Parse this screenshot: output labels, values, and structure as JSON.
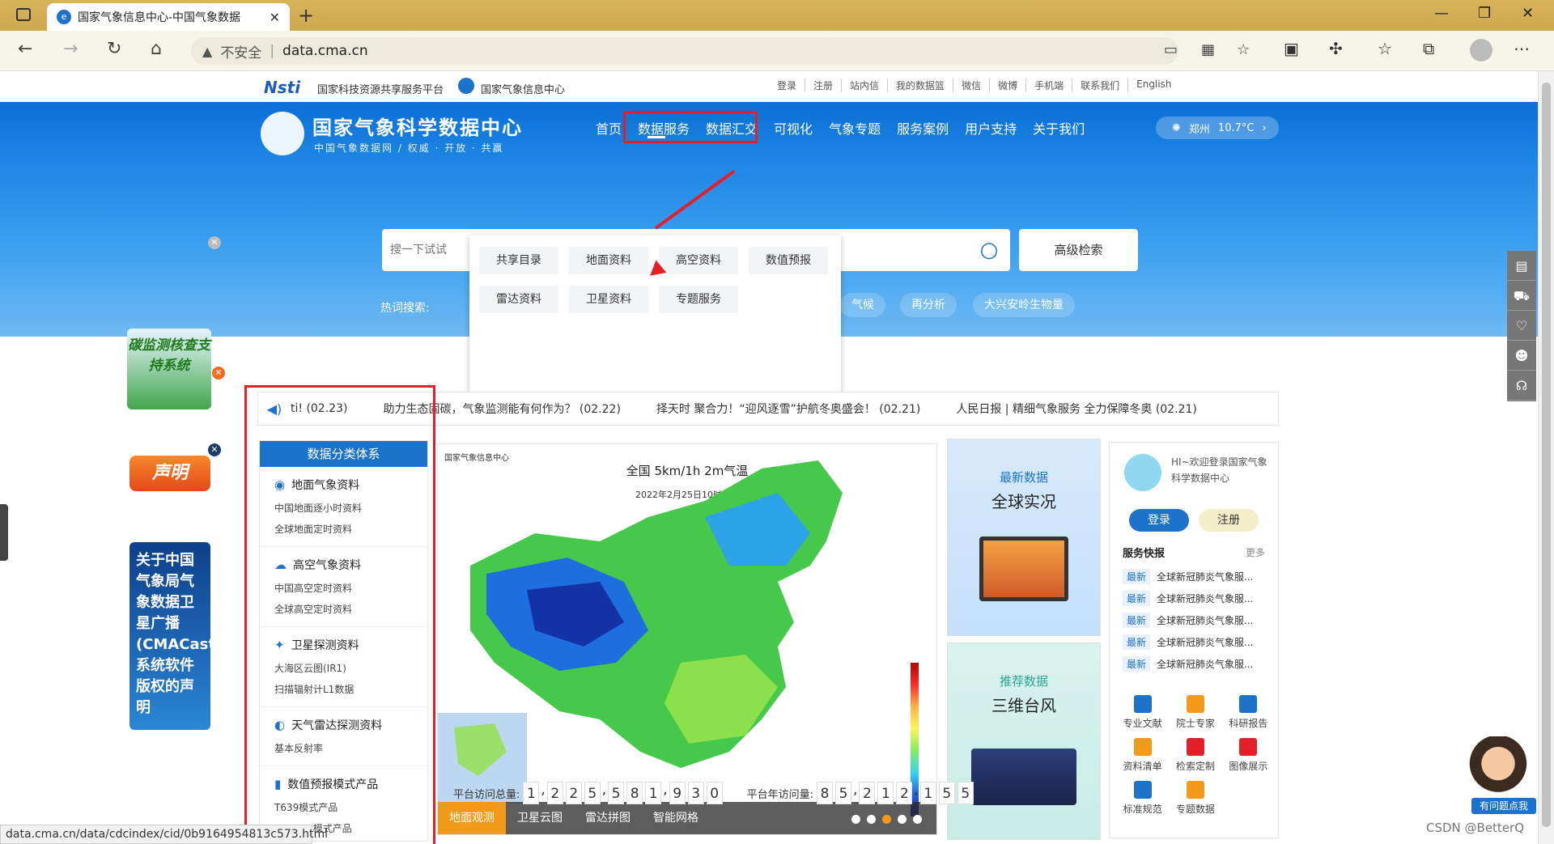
{
  "browser": {
    "tab_title": "国家气象信息中心-中国气象数据",
    "address": {
      "insecure_label": "不安全",
      "separator": "|",
      "domain": "data.cma.cn"
    }
  },
  "top_strip": {
    "nsti_logo": "Nsti",
    "nsti_text": "国家科技资源共享服务平台",
    "cma_text": "国家气象信息中心",
    "links": [
      "登录",
      "注册",
      "站内信",
      "我的数据篮",
      "微信",
      "微博",
      "手机端",
      "联系我们",
      "English"
    ]
  },
  "brand": {
    "title": "国家气象科学数据中心",
    "subtitle": "中国气象数据网 / 权威 · 开放 · 共赢"
  },
  "nav": [
    "首页",
    "数据服务",
    "数据汇交",
    "可视化",
    "气象专题",
    "服务案例",
    "用户支持",
    "关于我们"
  ],
  "weather": {
    "city": "郑州",
    "temp": "10.7°C"
  },
  "dropdown": {
    "row1": [
      "共享目录",
      "地面资料",
      "高空资料",
      "数值预报"
    ],
    "row2": [
      "雷达资料",
      "卫星资料",
      "专题服务"
    ]
  },
  "search": {
    "placeholder": "搜一下试试",
    "advanced": "高级检索",
    "hot_label": "热词搜索:",
    "hot_tags": [
      "气候",
      "再分析",
      "大兴安岭生物量"
    ]
  },
  "carbon": {
    "text": "碳监测核查支持系统"
  },
  "ticker": {
    "items": [
      "ti! (02.23)",
      "助力生态固碳，气象监测能有何作为？ (02.22)",
      "择天时 聚合力！“迎风逐雪”护航冬奥盛会！ (02.21)",
      "人民日报 | 精细气象服务 全力保障冬奥 (02.21)"
    ]
  },
  "left_float": {
    "shengming": "声明",
    "cmacast": "关于中国气象局气象数据卫星广播(CMACast)系统软件版权的声明"
  },
  "categories": {
    "header": "数据分类体系",
    "groups": [
      {
        "title": "地面气象资料",
        "items": [
          "中国地面逐小时资料",
          "全球地面定时资料"
        ]
      },
      {
        "title": "高空气象资料",
        "items": [
          "中国高空定时资料",
          "全球高空定时资料"
        ]
      },
      {
        "title": "卫星探测资料",
        "items": [
          "大海区云图(IR1)",
          "扫描辐射计L1数据"
        ]
      },
      {
        "title": "天气雷达探测资料",
        "items": [
          "基本反射率"
        ]
      },
      {
        "title": "数值预报模式产品",
        "items": [
          "T639模式产品",
          "GRAPES模式产品"
        ]
      }
    ]
  },
  "map": {
    "logo": "国家气象信息中心",
    "title": "全国 5km/1h 2m气温",
    "date": "2022年2月25日10时 BJT",
    "tabs": [
      "地面观测",
      "卫星云图",
      "雷达拼图",
      "智能网格"
    ],
    "active_tab": 0,
    "dots": 5,
    "active_dot": 2
  },
  "cards": [
    {
      "kicker": "最新数据",
      "big": "全球实况"
    },
    {
      "kicker": "推荐数据",
      "big": "三维台风"
    }
  ],
  "user_panel": {
    "hello": "HI~欢迎登录国家气象科学数据中心",
    "login": "登录",
    "register": "注册",
    "news_title": "服务快报",
    "more": "更多",
    "news": [
      {
        "tag": "最新",
        "text": "全球新冠肺炎气象服..."
      },
      {
        "tag": "最新",
        "text": "全球新冠肺炎气象服..."
      },
      {
        "tag": "最新",
        "text": "全球新冠肺炎气象服..."
      },
      {
        "tag": "最新",
        "text": "全球新冠肺炎气象服..."
      },
      {
        "tag": "最新",
        "text": "全球新冠肺炎气象服..."
      }
    ],
    "grid": [
      {
        "label": "专业文献",
        "color": "#1d73c9"
      },
      {
        "label": "院士专家",
        "color": "#f39a1b"
      },
      {
        "label": "科研报告",
        "color": "#1d73c9"
      },
      {
        "label": "资料清单",
        "color": "#f39a1b"
      },
      {
        "label": "检索定制",
        "color": "#e3202a"
      },
      {
        "label": "图像展示",
        "color": "#e3202a"
      },
      {
        "label": "标准规范",
        "color": "#1d73c9"
      },
      {
        "label": "专题数据",
        "color": "#f39a1b"
      }
    ]
  },
  "counter": {
    "total_label": "平台访问总量:",
    "total": "1,225,581,930",
    "year_label": "平台年访问量:",
    "year": "85,212,155"
  },
  "help": "有问题点我",
  "status_url": "data.cma.cn/data/cdcindex/cid/0b9164954813c573.html",
  "watermark": "CSDN @BetterQ"
}
